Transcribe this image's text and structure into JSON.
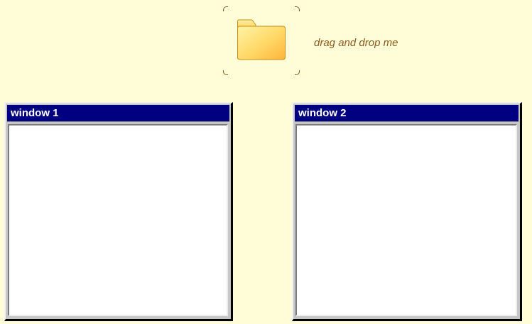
{
  "drag_source": {
    "label": "drag and drop me",
    "icon": "folder-icon"
  },
  "windows": [
    {
      "title": "window 1"
    },
    {
      "title": "window 2"
    }
  ],
  "colors": {
    "background": "#fffdd8",
    "titlebar": "#000080",
    "label": "#8a5a1c",
    "folder": "#ffd866"
  }
}
